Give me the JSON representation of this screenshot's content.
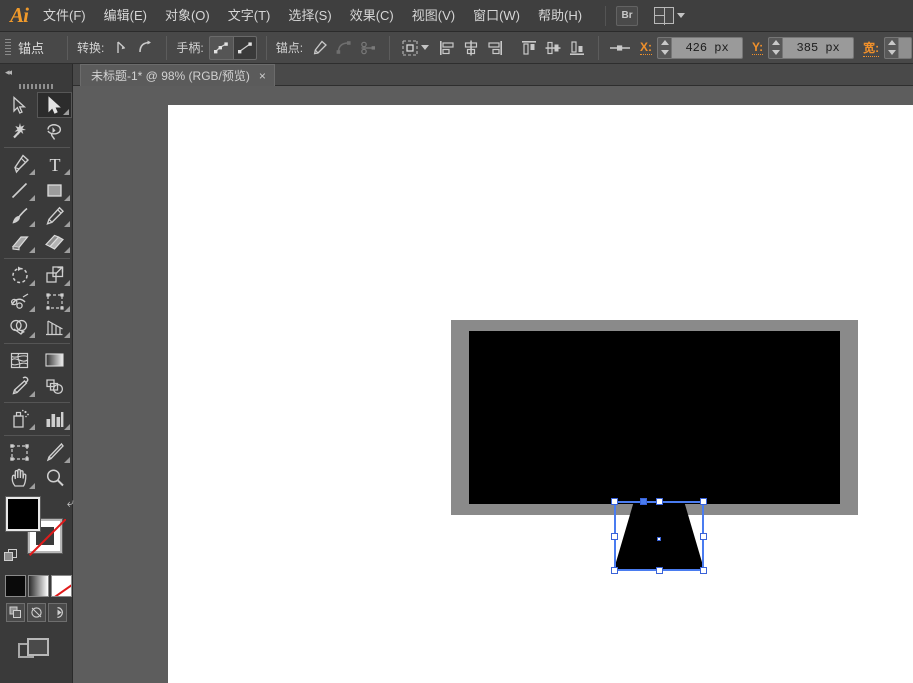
{
  "app": {
    "name": "Adobe Illustrator",
    "logo_text": "Ai"
  },
  "menubar": {
    "items": [
      {
        "label": "文件(F)",
        "name": "menu-file"
      },
      {
        "label": "编辑(E)",
        "name": "menu-edit"
      },
      {
        "label": "对象(O)",
        "name": "menu-object"
      },
      {
        "label": "文字(T)",
        "name": "menu-type"
      },
      {
        "label": "选择(S)",
        "name": "menu-select"
      },
      {
        "label": "效果(C)",
        "name": "menu-effect"
      },
      {
        "label": "视图(V)",
        "name": "menu-view"
      },
      {
        "label": "窗口(W)",
        "name": "menu-window"
      },
      {
        "label": "帮助(H)",
        "name": "menu-help"
      }
    ],
    "bridge_label": "Br",
    "workspace_label": ""
  },
  "controlbar": {
    "tool_title": "锚点",
    "convert_label": "转换:",
    "handles_label": "手柄:",
    "anchor_label": "锚点:",
    "x_label": "X:",
    "x_value": "426 px",
    "y_label": "Y:",
    "y_value": "385 px",
    "w_label": "宽:",
    "w_value": ""
  },
  "tools": {
    "collapse_label": "◂◂",
    "items": [
      {
        "name": "selection-tool",
        "label": "选择工具",
        "selected": false
      },
      {
        "name": "direct-selection-tool",
        "label": "直接选择工具",
        "selected": true
      },
      {
        "name": "magic-wand-tool",
        "label": "魔棒工具",
        "selected": false
      },
      {
        "name": "lasso-tool",
        "label": "套索工具",
        "selected": false
      },
      {
        "name": "pen-tool",
        "label": "钢笔工具",
        "selected": false
      },
      {
        "name": "type-tool",
        "label": "文字工具",
        "selected": false
      },
      {
        "name": "line-segment-tool",
        "label": "直线段工具",
        "selected": false
      },
      {
        "name": "rectangle-tool",
        "label": "矩形工具",
        "selected": false
      },
      {
        "name": "paintbrush-tool",
        "label": "画笔工具",
        "selected": false
      },
      {
        "name": "pencil-tool",
        "label": "铅笔工具",
        "selected": false
      },
      {
        "name": "blob-brush-tool",
        "label": "斑点画笔工具",
        "selected": false
      },
      {
        "name": "eraser-tool",
        "label": "橡皮擦工具",
        "selected": false
      },
      {
        "name": "rotate-tool",
        "label": "旋转工具",
        "selected": false
      },
      {
        "name": "scale-tool",
        "label": "比例缩放工具",
        "selected": false
      },
      {
        "name": "width-tool",
        "label": "宽度工具",
        "selected": false
      },
      {
        "name": "free-transform-tool",
        "label": "自由变换工具",
        "selected": false
      },
      {
        "name": "shape-builder-tool",
        "label": "形状生成器工具",
        "selected": false
      },
      {
        "name": "perspective-grid-tool",
        "label": "透视网格工具",
        "selected": false
      },
      {
        "name": "mesh-tool",
        "label": "网格工具",
        "selected": false
      },
      {
        "name": "gradient-tool",
        "label": "渐变工具",
        "selected": false
      },
      {
        "name": "eyedropper-tool",
        "label": "吸管工具",
        "selected": false
      },
      {
        "name": "blend-tool",
        "label": "混合工具",
        "selected": false
      },
      {
        "name": "symbol-sprayer-tool",
        "label": "符号喷枪工具",
        "selected": false
      },
      {
        "name": "column-graph-tool",
        "label": "柱形图工具",
        "selected": false
      },
      {
        "name": "artboard-tool",
        "label": "画板工具",
        "selected": false
      },
      {
        "name": "slice-tool",
        "label": "切片工具",
        "selected": false
      },
      {
        "name": "hand-tool",
        "label": "抓手工具",
        "selected": false
      },
      {
        "name": "zoom-tool",
        "label": "缩放工具",
        "selected": false
      }
    ],
    "fill_color": "#000000",
    "stroke_color": "none",
    "swap_label": "⤶",
    "swatch_modes": [
      {
        "name": "color-swatch",
        "label": "颜色"
      },
      {
        "name": "gradient-swatch",
        "label": "渐变"
      },
      {
        "name": "none-swatch",
        "label": "无"
      }
    ],
    "drawing_modes": [
      {
        "name": "draw-normal-mode",
        "label": "正常绘图"
      },
      {
        "name": "draw-behind-mode",
        "label": "背面绘图"
      },
      {
        "name": "draw-inside-mode",
        "label": "内部绘图"
      }
    ],
    "screen_mode_label": "更改屏幕模式"
  },
  "document": {
    "tab_title": "未标题-1* @ 98% (RGB/预览)",
    "close_label": "×",
    "zoom": "98%",
    "color_mode": "RGB",
    "view_mode": "预览"
  },
  "artwork": {
    "monitor_frame_color": "#8a8a8a",
    "monitor_screen_color": "#000000",
    "stand_color": "#000000",
    "selection_color": "#4a7cf0",
    "handle_color": "#ffffff"
  }
}
